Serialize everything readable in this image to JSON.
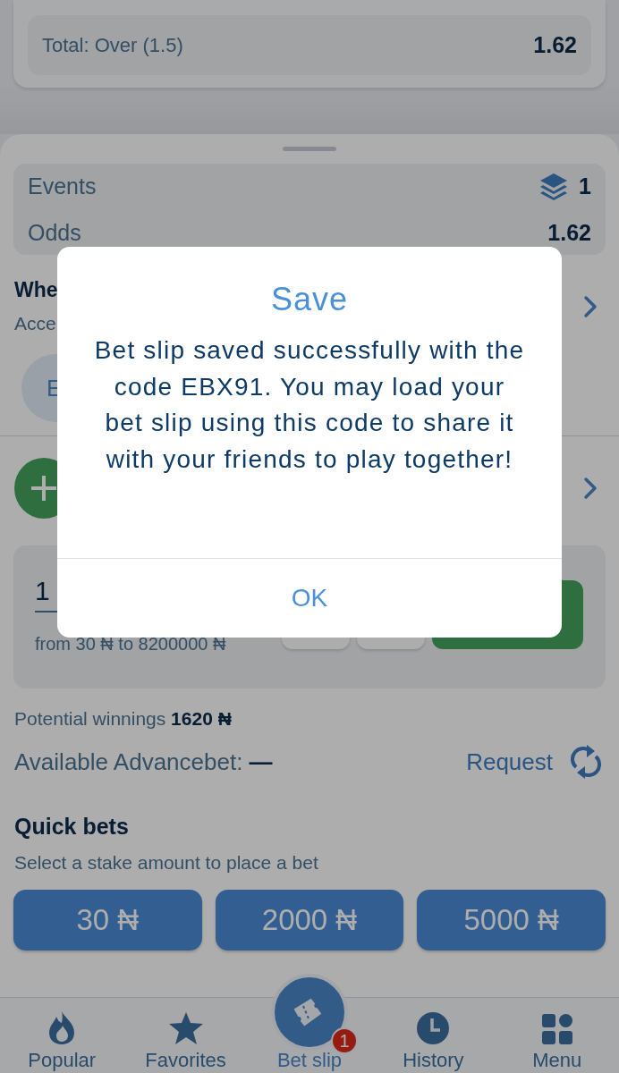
{
  "top_card": {
    "selection": "Total: Over (1.5)",
    "odds": "1.62"
  },
  "summary": {
    "events_label": "Events",
    "events_count": "1",
    "odds_label": "Odds",
    "odds_value": "1.62"
  },
  "option_row": {
    "title": "Whe",
    "subtitle": "Acce"
  },
  "chip": {
    "label": "E"
  },
  "stake": {
    "value": "1",
    "range": "from 30 ₦ to 8200000 ₦"
  },
  "potential": "Potential winnings **1620 ₦**",
  "advancebet": {
    "label": "Available Advancebet: **—**",
    "action": "Request"
  },
  "quick_bets": {
    "title": "Quick bets",
    "hint": "Select a stake amount to place a bet",
    "amounts": [
      "30 ₦",
      "2000 ₦",
      "5000 ₦"
    ]
  },
  "nav": [
    {
      "label": "Popular",
      "selected": false
    },
    {
      "label": "Favorites",
      "selected": false
    },
    {
      "label": "Bet slip",
      "selected": true,
      "badge": "1"
    },
    {
      "label": "History",
      "selected": false
    },
    {
      "label": "Menu",
      "selected": false
    }
  ],
  "dialog": {
    "title": "Save",
    "message": "Bet slip saved successfully with the code EBX91. You may load your bet slip using this code to share it with your friends to play together!",
    "button": "OK"
  }
}
